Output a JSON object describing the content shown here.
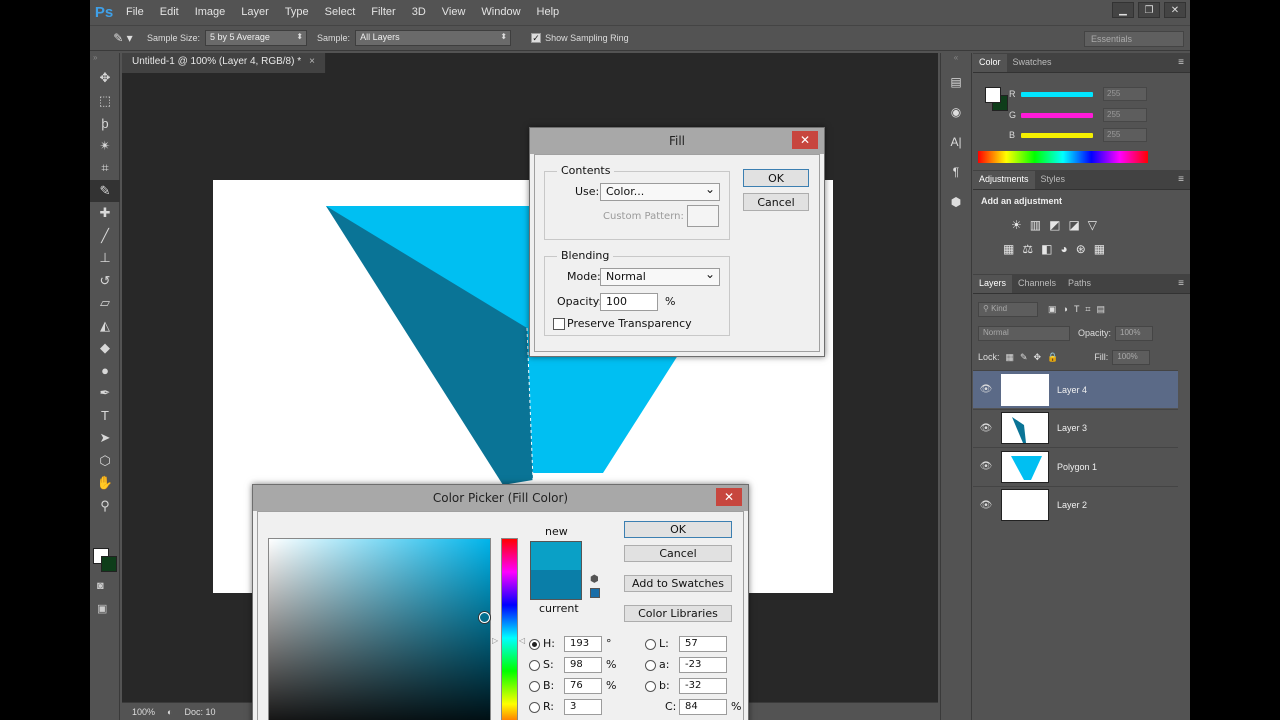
{
  "app": {
    "logo": "Ps"
  },
  "menu": [
    "File",
    "Edit",
    "Image",
    "Layer",
    "Type",
    "Select",
    "Filter",
    "3D",
    "View",
    "Window",
    "Help"
  ],
  "window_buttons": [
    "▁",
    "❐",
    "✕"
  ],
  "options": {
    "sample_size_label": "Sample Size:",
    "sample_size_value": "5 by 5 Average",
    "sample_label": "Sample:",
    "sample_value": "All Layers",
    "show_ring_label": "Show Sampling Ring",
    "show_ring_checked": true,
    "workspace": "Essentials"
  },
  "document": {
    "tab_title": "Untitled-1 @ 100% (Layer 4, RGB/8) *",
    "zoom": "100%",
    "doc_label": "Doc: 10"
  },
  "tools": [
    "move",
    "marquee",
    "lasso",
    "magic-wand",
    "crop",
    "eyedropper",
    "healing",
    "brush",
    "stamp",
    "history-brush",
    "eraser",
    "gradient",
    "blur",
    "dodge",
    "pen",
    "type",
    "path-select",
    "shape",
    "hand",
    "zoom"
  ],
  "color_panel": {
    "tabs": [
      "Color",
      "Swatches"
    ],
    "channels": [
      {
        "label": "R",
        "value": "255",
        "color": "#00e5ff"
      },
      {
        "label": "G",
        "value": "255",
        "color": "#ff1ad9"
      },
      {
        "label": "B",
        "value": "255",
        "color": "#f4f000"
      }
    ]
  },
  "adjustments_panel": {
    "tabs": [
      "Adjustments",
      "Styles"
    ],
    "title": "Add an adjustment"
  },
  "layers_panel": {
    "tabs": [
      "Layers",
      "Channels",
      "Paths"
    ],
    "kind": "Kind",
    "blend_mode": "Normal",
    "opacity_label": "Opacity:",
    "opacity_value": "100%",
    "lock_label": "Lock:",
    "fill_label": "Fill:",
    "fill_value": "100%",
    "layers": [
      {
        "name": "Layer 4",
        "selected": true,
        "thumb": "empty"
      },
      {
        "name": "Layer 3",
        "selected": false,
        "thumb": "shard"
      },
      {
        "name": "Polygon 1",
        "selected": false,
        "thumb": "triangle"
      },
      {
        "name": "Layer 2",
        "selected": false,
        "thumb": "white"
      }
    ]
  },
  "fill_dialog": {
    "title": "Fill",
    "contents_label": "Contents",
    "use_label": "Use:",
    "use_value": "Color...",
    "custom_pattern_label": "Custom Pattern:",
    "blending_label": "Blending",
    "mode_label": "Mode:",
    "mode_value": "Normal",
    "opacity_label": "Opacity:",
    "opacity_value": "100",
    "opacity_unit": "%",
    "preserve_label": "Preserve Transparency",
    "ok": "OK",
    "cancel": "Cancel"
  },
  "color_picker": {
    "title": "Color Picker (Fill Color)",
    "new_label": "new",
    "current_label": "current",
    "new_color": "#0aa0c6",
    "current_color": "#0a7ea8",
    "ok": "OK",
    "cancel": "Cancel",
    "add_swatches": "Add to Swatches",
    "color_libraries": "Color Libraries",
    "fields_left": [
      {
        "label": "H:",
        "value": "193",
        "unit": "°",
        "checked": true
      },
      {
        "label": "S:",
        "value": "98",
        "unit": "%",
        "checked": false
      },
      {
        "label": "B:",
        "value": "76",
        "unit": "%",
        "checked": false
      },
      {
        "label": "R:",
        "value": "3",
        "unit": "",
        "checked": false
      }
    ],
    "fields_right": [
      {
        "label": "L:",
        "value": "57",
        "unit": ""
      },
      {
        "label": "a:",
        "value": "-23",
        "unit": ""
      },
      {
        "label": "b:",
        "value": "-32",
        "unit": ""
      },
      {
        "label": "C:",
        "value": "84",
        "unit": "%"
      }
    ]
  },
  "colors": {
    "cyan": "#00bff2",
    "dark_teal": "#0a7496",
    "selected_layer": "#5b6a87"
  }
}
